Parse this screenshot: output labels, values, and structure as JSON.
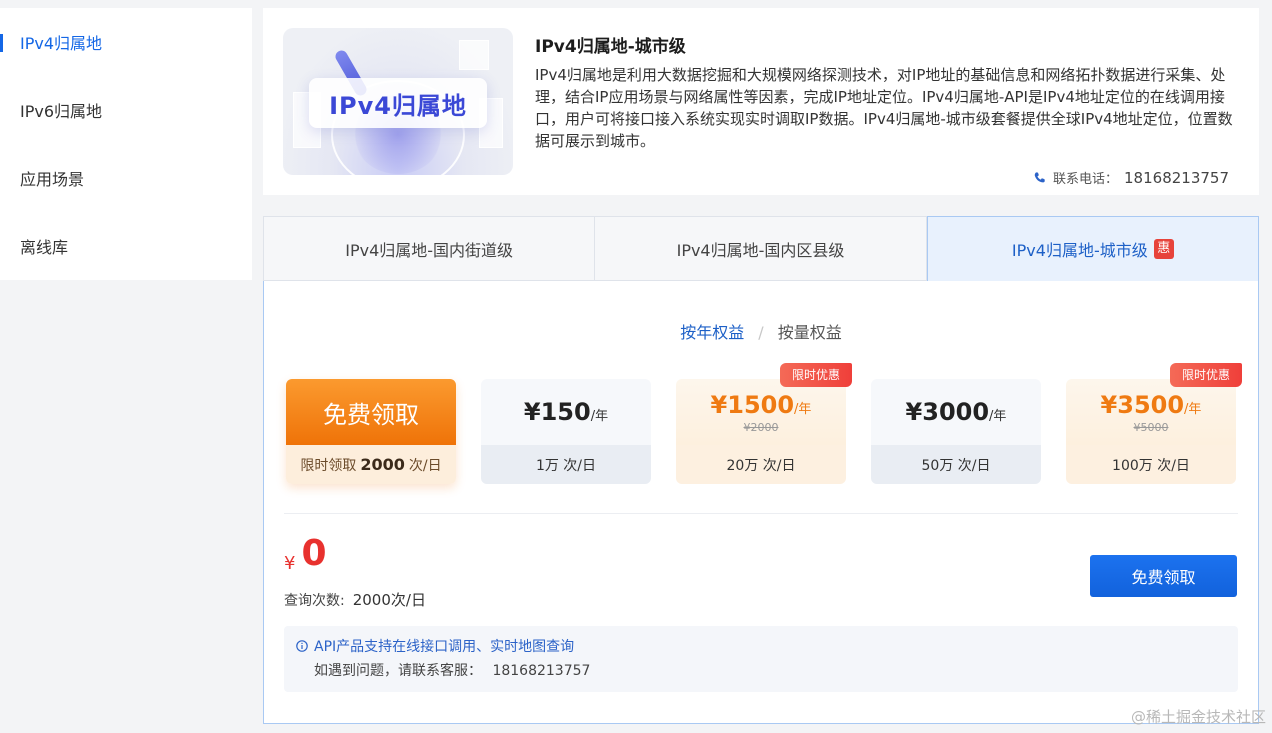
{
  "sidebar": {
    "items": [
      {
        "label": "IPv4归属地",
        "active": true
      },
      {
        "label": "IPv6归属地",
        "active": false
      },
      {
        "label": "应用场景",
        "active": false
      },
      {
        "label": "离线库",
        "active": false
      }
    ]
  },
  "product": {
    "thumb_text": "IPv4归属地",
    "title": "IPv4归属地-城市级",
    "description": "IPv4归属地是利用大数据挖掘和大规模网络探测技术，对IP地址的基础信息和网络拓扑数据进行采集、处理，结合IP应用场景与网络属性等因素，完成IP地址定位。IPv4归属地-API是IPv4地址定位的在线调用接口，用户可将接口接入系统实现实时调取IP数据。IPv4归属地-城市级套餐提供全球IPv4地址定位，位置数据可展示到城市。",
    "phone_label": "联系电话：",
    "phone": "18168213757",
    "icon": "phone-icon"
  },
  "tabs": [
    {
      "label": "IPv4归属地-国内街道级",
      "active": false
    },
    {
      "label": "IPv4归属地-国内区县级",
      "active": false
    },
    {
      "label": "IPv4归属地-城市级",
      "active": true,
      "badge": "惠"
    }
  ],
  "mode_switch": {
    "year": "按年权益",
    "sep": "/",
    "quantity": "按量权益"
  },
  "plans": [
    {
      "type": "free",
      "title": "免费领取",
      "bottom_prefix": "限时领取",
      "bottom_count": "2000",
      "bottom_suffix": "次/日"
    },
    {
      "type": "normal",
      "price": "¥150",
      "unit": "/年",
      "quota": "1万 次/日"
    },
    {
      "type": "promo",
      "price": "¥1500",
      "unit": "/年",
      "original": "¥2000",
      "quota": "20万 次/日",
      "ribbon": "限时优惠"
    },
    {
      "type": "normal",
      "price": "¥3000",
      "unit": "/年",
      "quota": "50万 次/日"
    },
    {
      "type": "promo",
      "price": "¥3500",
      "unit": "/年",
      "original": "¥5000",
      "quota": "100万 次/日",
      "ribbon": "限时优惠"
    }
  ],
  "summary": {
    "currency": "¥",
    "amount": "0",
    "query_label": "查询次数:",
    "query_value": "2000次/日",
    "button": "免费领取"
  },
  "notice": {
    "line1": "API产品支持在线接口调用、实时地图查询",
    "line2_label": "如遇到问题，请联系客服：",
    "line2_phone": "18168213757",
    "icon": "info-icon"
  },
  "watermark": "@稀土掘金技术社区",
  "colors": {
    "accent": "#1467e6",
    "orange": "#ef7a12",
    "red": "#e8312e"
  }
}
